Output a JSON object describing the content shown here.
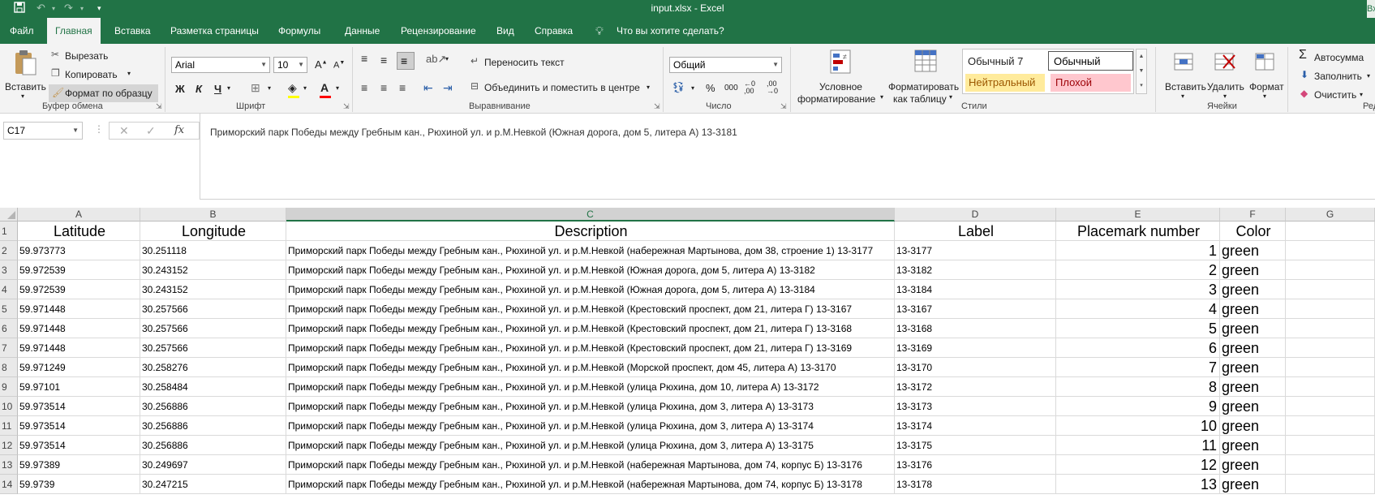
{
  "window": {
    "title": "input.xlsx  -  Excel",
    "signin_fragment": "Вх"
  },
  "tabs": [
    "Файл",
    "Главная",
    "Вставка",
    "Разметка страницы",
    "Формулы",
    "Данные",
    "Рецензирование",
    "Вид",
    "Справка"
  ],
  "active_tab": "Главная",
  "tell_me": "Что вы хотите сделать?",
  "ribbon": {
    "clipboard": {
      "paste": "Вставить",
      "cut": "Вырезать",
      "copy": "Копировать",
      "format_painter": "Формат по образцу",
      "label": "Буфер обмена"
    },
    "font": {
      "name": "Arial",
      "size": "10",
      "label": "Шрифт",
      "bold": "Ж",
      "italic": "К",
      "underline": "Ч"
    },
    "alignment": {
      "wrap": "Переносить текст",
      "merge": "Объединить и поместить в центре",
      "label": "Выравнивание"
    },
    "number": {
      "format": "Общий",
      "percent": "%",
      "thousands": "000",
      "label": "Число"
    },
    "styles": {
      "conditional_1": "Условное",
      "conditional_2": "форматирование",
      "as_table_1": "Форматировать",
      "as_table_2": "как таблицу",
      "style_normal7": "Обычный 7",
      "style_normal": "Обычный",
      "style_neutral": "Нейтральный",
      "style_bad": "Плохой",
      "label": "Стили"
    },
    "cells": {
      "insert": "Вставить",
      "delete": "Удалить",
      "format": "Формат",
      "label": "Ячейки"
    },
    "editing": {
      "autosum": "Автосумма",
      "fill": "Заполнить",
      "clear": "Очистить",
      "label_fragment": "Ред"
    }
  },
  "namebox": "C17",
  "formula": "Приморский парк Победы между Гребным кан., Рюхиной ул. и р.М.Невкой (Южная дорога, дом 5, литера А) 13-3181",
  "columns": [
    "A",
    "B",
    "C",
    "D",
    "E",
    "F",
    "G"
  ],
  "selected_column": "C",
  "header_row": [
    "Latitude",
    "Longitude",
    "Description",
    "Label",
    "Placemark number",
    "Color"
  ],
  "rows": [
    [
      "59.973773",
      "30.251118",
      "Приморский парк Победы между Гребным кан., Рюхиной ул. и р.М.Невкой (набережная Мартынова, дом 38, строение 1) 13-3177",
      "13-3177",
      "1",
      "green"
    ],
    [
      "59.972539",
      "30.243152",
      "Приморский парк Победы между Гребным кан., Рюхиной ул. и р.М.Невкой (Южная дорога, дом 5, литера А) 13-3182",
      "13-3182",
      "2",
      "green"
    ],
    [
      "59.972539",
      "30.243152",
      "Приморский парк Победы между Гребным кан., Рюхиной ул. и р.М.Невкой (Южная дорога, дом 5, литера А) 13-3184",
      "13-3184",
      "3",
      "green"
    ],
    [
      "59.971448",
      "30.257566",
      "Приморский парк Победы между Гребным кан., Рюхиной ул. и р.М.Невкой (Крестовский проспект, дом 21, литера Г) 13-3167",
      "13-3167",
      "4",
      "green"
    ],
    [
      "59.971448",
      "30.257566",
      "Приморский парк Победы между Гребным кан., Рюхиной ул. и р.М.Невкой (Крестовский проспект, дом 21, литера Г) 13-3168",
      "13-3168",
      "5",
      "green"
    ],
    [
      "59.971448",
      "30.257566",
      "Приморский парк Победы между Гребным кан., Рюхиной ул. и р.М.Невкой (Крестовский проспект, дом 21, литера Г) 13-3169",
      "13-3169",
      "6",
      "green"
    ],
    [
      "59.971249",
      "30.258276",
      "Приморский парк Победы между Гребным кан., Рюхиной ул. и р.М.Невкой (Морской проспект, дом 45, литера А) 13-3170",
      "13-3170",
      "7",
      "green"
    ],
    [
      "59.97101",
      "30.258484",
      "Приморский парк Победы между Гребным кан., Рюхиной ул. и р.М.Невкой (улица Рюхина, дом 10, литера А) 13-3172",
      "13-3172",
      "8",
      "green"
    ],
    [
      "59.973514",
      "30.256886",
      "Приморский парк Победы между Гребным кан., Рюхиной ул. и р.М.Невкой (улица Рюхина, дом 3, литера А) 13-3173",
      "13-3173",
      "9",
      "green"
    ],
    [
      "59.973514",
      "30.256886",
      "Приморский парк Победы между Гребным кан., Рюхиной ул. и р.М.Невкой (улица Рюхина, дом 3, литера А) 13-3174",
      "13-3174",
      "10",
      "green"
    ],
    [
      "59.973514",
      "30.256886",
      "Приморский парк Победы между Гребным кан., Рюхиной ул. и р.М.Невкой (улица Рюхина, дом 3, литера А) 13-3175",
      "13-3175",
      "11",
      "green"
    ],
    [
      "59.97389",
      "30.249697",
      "Приморский парк Победы между Гребным кан., Рюхиной ул. и р.М.Невкой (набережная Мартынова, дом 74, корпус Б) 13-3176",
      "13-3176",
      "12",
      "green"
    ],
    [
      "59.9739",
      "30.247215",
      "Приморский парк Победы между Гребным кан., Рюхиной ул. и р.М.Невкой (набережная Мартынова, дом 74, корпус Б) 13-3178",
      "13-3178",
      "13",
      "green"
    ]
  ],
  "colors": {
    "excel_green": "#217346",
    "neutral_bg": "#ffeb9c",
    "neutral_fg": "#9c5700",
    "bad_bg": "#ffc7ce",
    "bad_fg": "#9c0006"
  }
}
